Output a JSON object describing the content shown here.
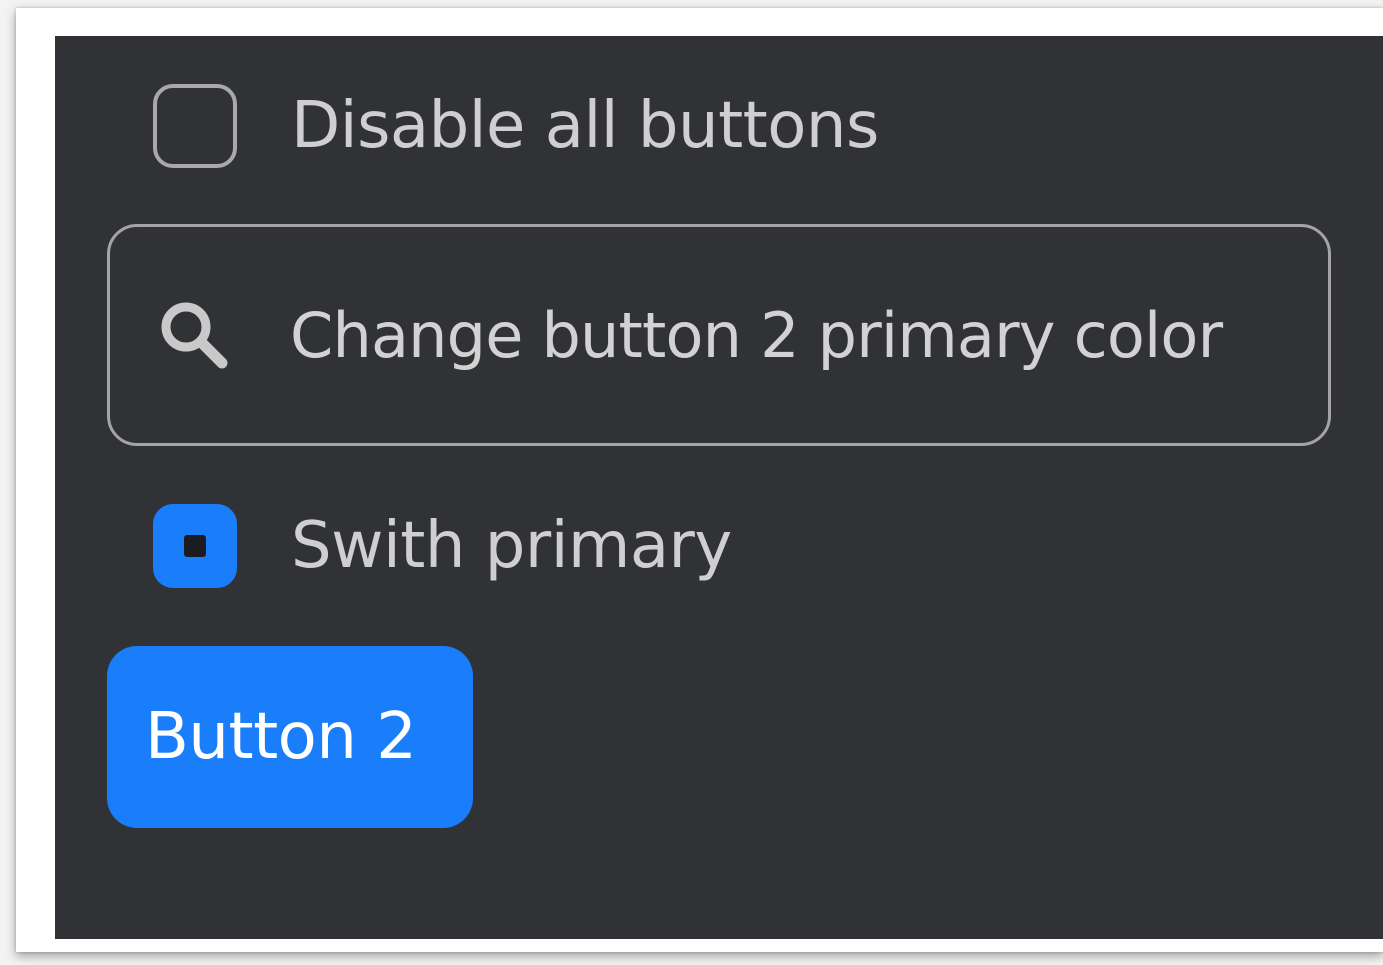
{
  "colors": {
    "accent": "#1a7efb",
    "panel_background": "#313236"
  },
  "disable_checkbox": {
    "label": "Disable all buttons",
    "checked": false
  },
  "search": {
    "icon": "search-icon",
    "value": "Change button 2 primary color"
  },
  "primary_checkbox": {
    "label": "Swith primary",
    "checked": true
  },
  "button2": {
    "label": "Button 2"
  }
}
